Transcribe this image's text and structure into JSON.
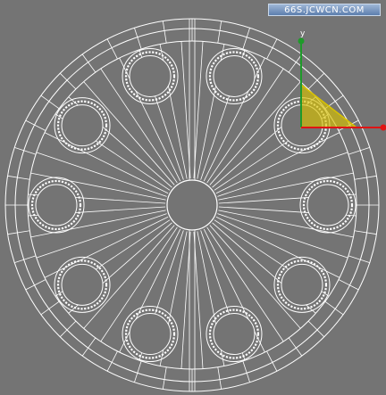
{
  "watermark": {
    "text": "66S.JCWCN.COM"
  },
  "gizmo": {
    "axis_y_label": "y"
  },
  "colors": {
    "background": "#747474",
    "wireframe": "#ffffff",
    "gizmo_y_axis": "#1f9a2a",
    "gizmo_x_axis": "#e01414",
    "gizmo_plane": "#d8c200"
  },
  "model": {
    "description_type": "wireframe-disc",
    "holes": 10,
    "radial_spokes": 48
  }
}
